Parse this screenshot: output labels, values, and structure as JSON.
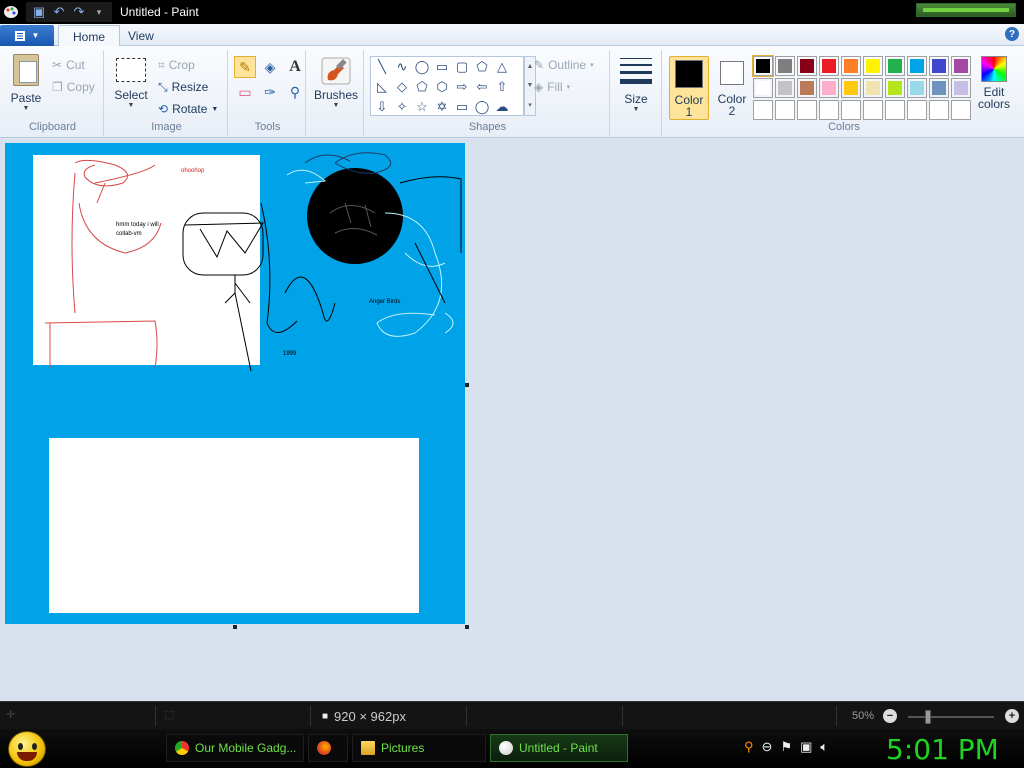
{
  "window": {
    "title": "Untitled - Paint"
  },
  "tabs": [
    {
      "label": "Home"
    },
    {
      "label": "View"
    }
  ],
  "ribbon": {
    "clipboard": {
      "paste": "Paste",
      "cut": "Cut",
      "copy": "Copy",
      "label": "Clipboard"
    },
    "image": {
      "select": "Select",
      "crop": "Crop",
      "resize": "Resize",
      "rotate": "Rotate",
      "label": "Image"
    },
    "tools": {
      "label": "Tools"
    },
    "brushes": {
      "label": "Brushes"
    },
    "shapes": {
      "outline": "Outline",
      "fill": "Fill",
      "label": "Shapes"
    },
    "size": {
      "label": "Size"
    },
    "colors": {
      "color1_label": "Color",
      "color1_num": "1",
      "color2_label": "Color",
      "color2_num": "2",
      "edit_label": "Edit",
      "edit_label2": "colors",
      "label": "Colors",
      "color1": "#000000",
      "color2": "#ffffff",
      "palette_row1": [
        "#000000",
        "#7f7f7f",
        "#880015",
        "#ed1c24",
        "#ff7f27",
        "#fff200",
        "#22b14c",
        "#00a2e8",
        "#3f48cc",
        "#a349a4"
      ],
      "palette_row2": [
        "#ffffff",
        "#c3c3c3",
        "#b97a57",
        "#ffaec9",
        "#ffc90e",
        "#efe4b0",
        "#b5e61d",
        "#99d9ea",
        "#7092be",
        "#c8bfe7"
      ]
    }
  },
  "canvas": {
    "background": "#00a2e8",
    "text_ohoohop": "ohoohop",
    "text_hmm1": "hmm today i will",
    "text_hmm2": "collab-vm",
    "text_anger": "Anger Birds",
    "text_1999": "1999"
  },
  "statusbar": {
    "dimensions": "920 × 962px",
    "zoom": "50%"
  },
  "taskbar": {
    "items": [
      {
        "label": "Our Mobile Gadg..."
      },
      {
        "label": ""
      },
      {
        "label": "Pictures"
      },
      {
        "label": "Untitled - Paint"
      }
    ],
    "clock": "5:01 PM"
  }
}
